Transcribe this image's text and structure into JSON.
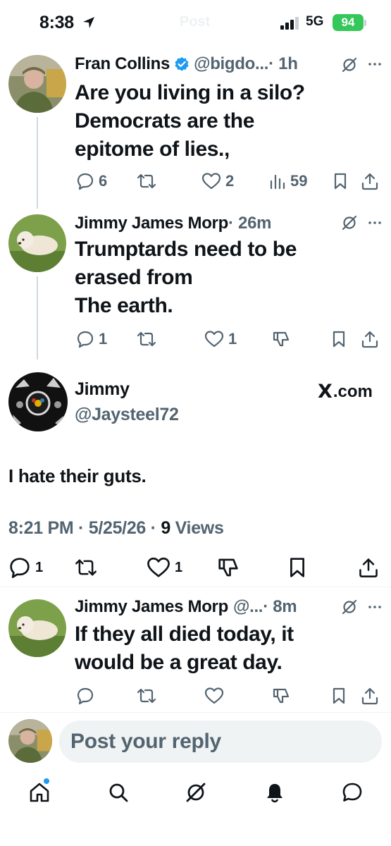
{
  "status_bar": {
    "time": "8:38",
    "faded_title": "Post",
    "network": "5G",
    "battery": "94"
  },
  "posts": [
    {
      "name": "Fran Collins",
      "verified": true,
      "handle": "@bigdo...",
      "time": "· 1h",
      "text": "Are you living in a silo?\nDemocrats are the\nepitome of lies.,",
      "replies": "6",
      "reposts": "",
      "likes": "2",
      "views": "59"
    },
    {
      "name": "Jimmy James Morp",
      "verified": false,
      "handle": "",
      "time": "· 26m",
      "text": "Trumptards need to be\nerased from\nThe earth.",
      "replies": "1",
      "reposts": "",
      "likes": "1"
    },
    {
      "name": "Jimmy James Morp",
      "verified": false,
      "handle": "@...",
      "time": "· 8m",
      "text": "If they all died today, it\nwould be a great day.",
      "replies": "",
      "reposts": "",
      "likes": ""
    }
  ],
  "main_tweet": {
    "name": "Jimmy",
    "handle": "@Jaysteel72",
    "source": ".com",
    "source_logo": "X",
    "text": "I hate their guts.",
    "time": "8:21 PM",
    "date": "5/25/26",
    "views": "9",
    "views_label": "Views",
    "replies": "1",
    "likes": "1"
  },
  "reply_box": {
    "placeholder": "Post your reply"
  },
  "nav": [
    "home-icon",
    "search-icon",
    "grok-icon",
    "notifications-icon",
    "messages-icon"
  ],
  "colors": {
    "text": "#0f1419",
    "secondary": "#536471",
    "verified": "#1d9bf0",
    "battery": "#34c759",
    "reply_bg": "#eff3f4"
  }
}
